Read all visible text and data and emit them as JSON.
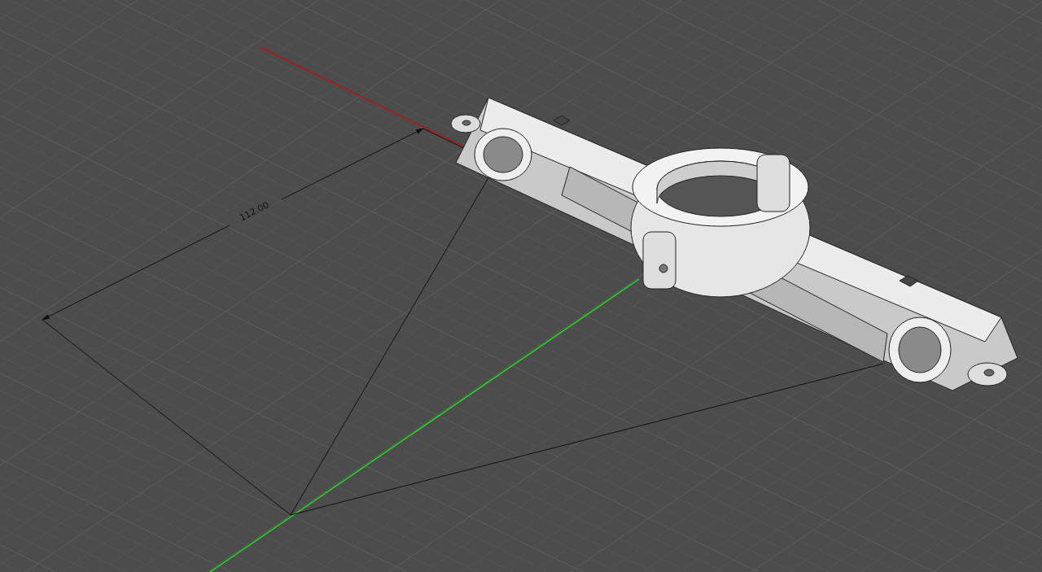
{
  "viewport": {
    "dimension": {
      "label": "112.00"
    }
  }
}
